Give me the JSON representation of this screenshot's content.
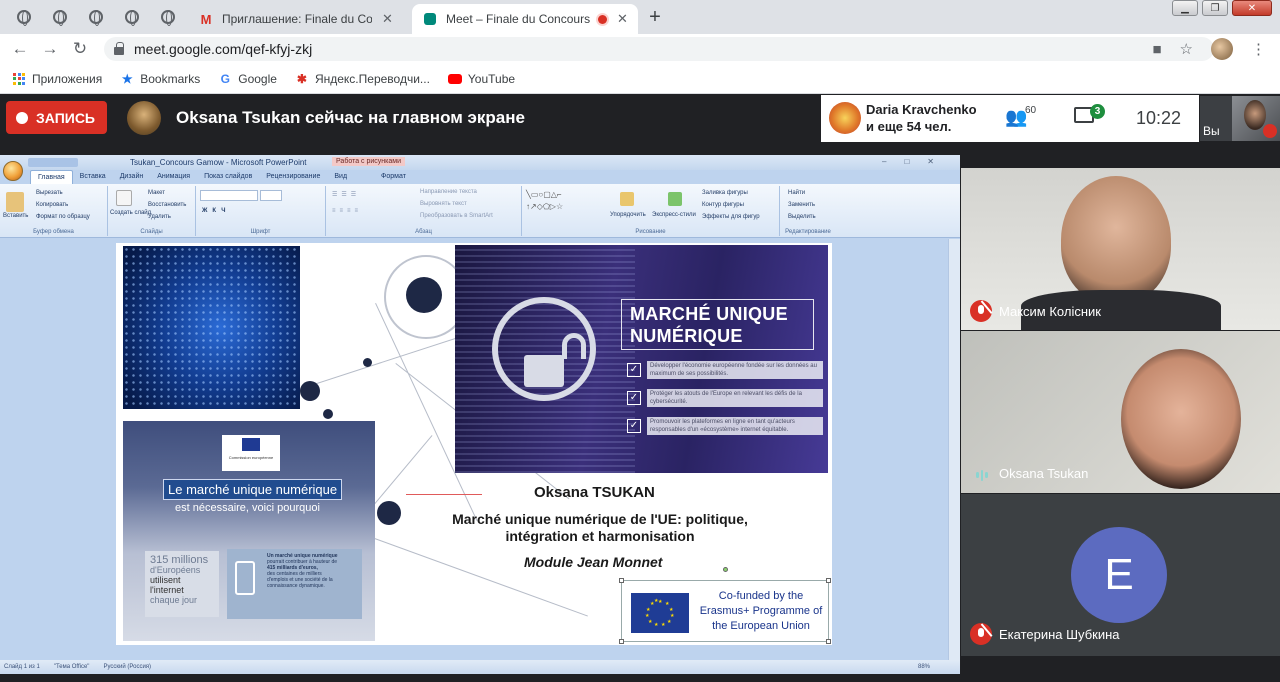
{
  "browser": {
    "tabs": [
      {
        "title": "Приглашение: Finale du Concou",
        "icon": "gmail-icon"
      },
      {
        "title": "Meet – Finale du Concours G",
        "icon": "meet-icon",
        "active": true,
        "recording": true
      }
    ],
    "url": "meet.google.com/qef-kfyj-zkj",
    "bookmarks": [
      "Приложения",
      "Bookmarks",
      "Google",
      "Яндекс.Переводчи...",
      "YouTube"
    ]
  },
  "meet": {
    "record_label": "ЗАПИСЬ",
    "presenting_title": "Oksana Tsukan сейчас на главном экране",
    "presenter_name": "Daria Kravchenko",
    "presenter_more": "и еще 54 чел.",
    "people_count": "60",
    "chat_badge": "3",
    "time": "10:22",
    "self_label": "Вы",
    "participants": [
      {
        "name": "Максим Колісник",
        "mic": "muted"
      },
      {
        "name": "Oksana Tsukan",
        "mic": "speaking"
      },
      {
        "name": "Екатерина Шубкина",
        "mic": "muted",
        "avatar_letter": "E",
        "avatar_color": "#5c6bc0"
      }
    ]
  },
  "ppt": {
    "window_title": "Tsukan_Concours Gamow - Microsoft PowerPoint",
    "context_tab": "Работа с рисунками",
    "tabs": [
      "Главная",
      "Вставка",
      "Дизайн",
      "Анимация",
      "Показ слайдов",
      "Рецензирование",
      "Вид",
      "Формат"
    ],
    "groups": [
      "Буфер обмена",
      "Слайды",
      "Шрифт",
      "Абзац",
      "Рисование",
      "Редактирование"
    ],
    "clipboard": {
      "paste": "Вставить",
      "cut": "Вырезать",
      "copy": "Копировать",
      "format": "Формат по образцу"
    },
    "slides": {
      "create": "Создать слайд",
      "layout": "Макет",
      "reset": "Восстановить",
      "delete": "Удалить"
    },
    "paragraph": {
      "direction": "Направление текста",
      "align": "Выровнять текст",
      "smartart": "Преобразовать в SmartArt"
    },
    "drawing": {
      "arrange": "Упорядочить",
      "styles": "Экспресс-стили",
      "fill": "Заливка фигуры",
      "outline": "Контур фигуры",
      "effects": "Эффекты для фигур"
    },
    "editing": {
      "find": "Найти",
      "replace": "Заменить",
      "select": "Выделить"
    },
    "status": {
      "slide": "Слайд 1 из 1",
      "theme": "\"Тема Office\"",
      "lang": "Русский (Россия)",
      "zoom": "88%"
    },
    "slide": {
      "heading_box": "MARCHÉ UNIQUE NUMÉRIQUE",
      "bullets": [
        "Développer l'économie européenne fondée sur les données au maximum de ses possibilités.",
        "Protéger les atouts de l'Europe en relevant les défis de la cybersécurité.",
        "Promouvoir les plateformes en ligne en tant qu'acteurs responsables d'un «écosystème» internet équitable."
      ],
      "ec_logo": "Commission européenne",
      "lmu_title": "Le marché unique numérique",
      "lmu_sub": "est nécessaire, voici pourquoi",
      "stat1": [
        "315 millions",
        "d'Européens",
        "utilisent",
        "l'internet",
        "chaque jour"
      ],
      "stat2": [
        "Un marché unique numérique",
        "pourrait contribuer à hauteur de",
        "415 milliards d'euros,",
        "des centaines de milliers",
        "d'emplois et une société de la connaissance dynamique."
      ],
      "author": "Oksana TSUKAN",
      "subtitle": "Marché unique numérique de l'UE: politique, intégration et harmonisation",
      "module": "Module Jean Monnet",
      "cofund": "Co-funded by the Erasmus+ Programme of the European Union"
    }
  }
}
